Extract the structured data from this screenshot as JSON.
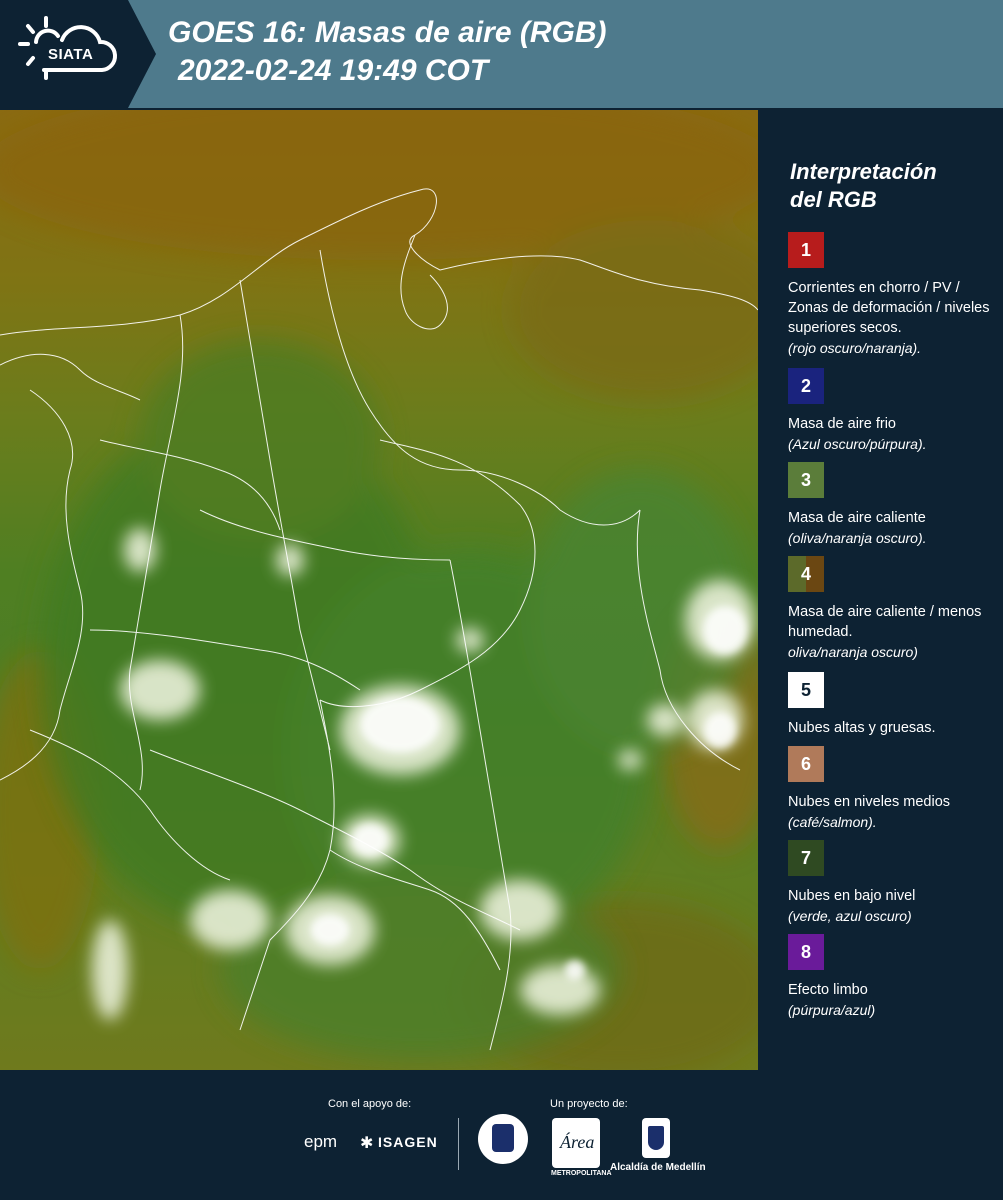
{
  "header": {
    "logo_text": "SIATA",
    "title_line1": "GOES 16: Masas de aire (RGB)",
    "title_line2": "2022-02-24 19:49 COT"
  },
  "legend": {
    "title_line1": "Interpretación",
    "title_line2": "del RGB",
    "items": [
      {
        "num": "1",
        "color": "#b71c1c",
        "desc": "Corrientes en chorro / PV / Zonas de deformación / niveles superiores secos.",
        "sub": "(rojo oscuro/naranja)."
      },
      {
        "num": "2",
        "color": "#1a237e",
        "desc": "Masa de aire frio",
        "sub": "(Azul oscuro/púrpura)."
      },
      {
        "num": "3",
        "color": "#5b7d3a",
        "desc": "Masa de aire caliente",
        "sub": "(oliva/naranja oscuro)."
      },
      {
        "num": "4",
        "color_a": "#5c6a2a",
        "color_b": "#6b4712",
        "desc": "Masa de aire caliente / menos humedad.",
        "sub": "oliva/naranja oscuro)"
      },
      {
        "num": "5",
        "color": "#ffffff",
        "desc": "Nubes altas y gruesas.",
        "sub": ""
      },
      {
        "num": "6",
        "color": "#b07a5a",
        "desc": "Nubes en niveles medios",
        "sub": "(café/salmon)."
      },
      {
        "num": "7",
        "color": "#2f4a22",
        "desc": "Nubes en bajo nivel",
        "sub": "(verde, azul oscuro)"
      },
      {
        "num": "8",
        "color": "#6a1b9a",
        "desc": "Efecto limbo",
        "sub": "(púrpura/azul)"
      }
    ]
  },
  "footer": {
    "support_label": "Con el apoyo de:",
    "project_label": "Un proyecto de:",
    "sponsor_1": "epm",
    "sponsor_2": "ISAGEN",
    "partner_1": "METROPOLITANA",
    "partner_2": "Alcaldía de Medellín"
  }
}
